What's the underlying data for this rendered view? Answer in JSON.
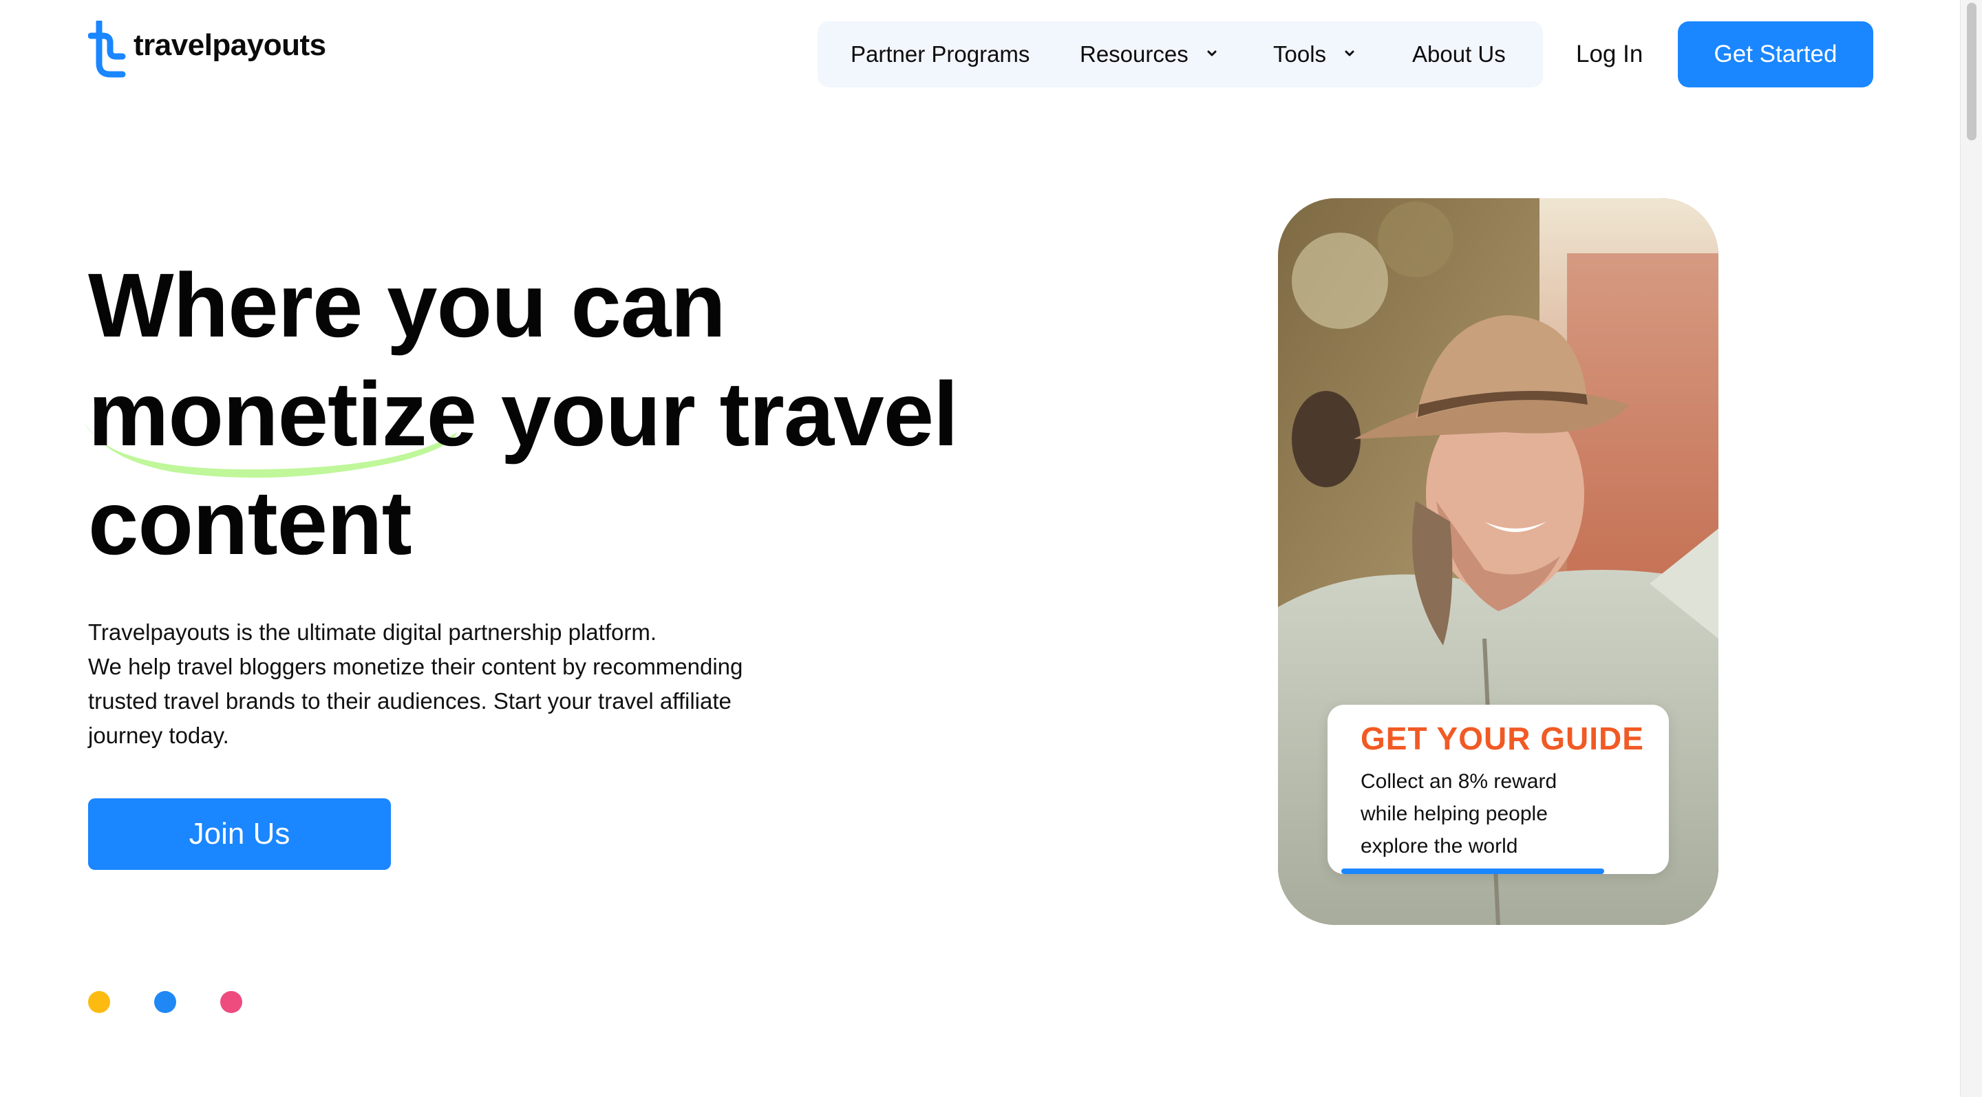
{
  "brand": {
    "name": "travelpayouts"
  },
  "nav": {
    "items": [
      {
        "label": "Partner Programs",
        "has_dropdown": false
      },
      {
        "label": "Resources",
        "has_dropdown": true
      },
      {
        "label": "Tools",
        "has_dropdown": true
      },
      {
        "label": "About Us",
        "has_dropdown": false
      }
    ],
    "login_label": "Log In",
    "cta_label": "Get Started"
  },
  "hero": {
    "headline_line1": "Where you can",
    "headline_highlight": "monetize",
    "headline_line2_rest": " your travel",
    "headline_line3": "content",
    "description": [
      "Travelpayouts is the ultimate digital partnership platform.",
      "We help travel bloggers monetize their content by recommending",
      "trusted travel brands to their audiences. Start your travel affiliate",
      "journey today."
    ],
    "cta_label": "Join Us"
  },
  "slider_dots": [
    {
      "color": "#fdbb11"
    },
    {
      "color": "#1f88f5"
    },
    {
      "color": "#ee4b7e"
    }
  ],
  "promo_card": {
    "brand": "GET YOUR GUIDE",
    "text": [
      "Collect an 8% reward",
      "while helping people",
      "explore the world"
    ],
    "progress": 0.77
  },
  "colors": {
    "accent": "#1a86ff",
    "highlight": "#bff79a",
    "promo_brand": "#f15a24",
    "nav_bg": "#f2f6fd"
  }
}
